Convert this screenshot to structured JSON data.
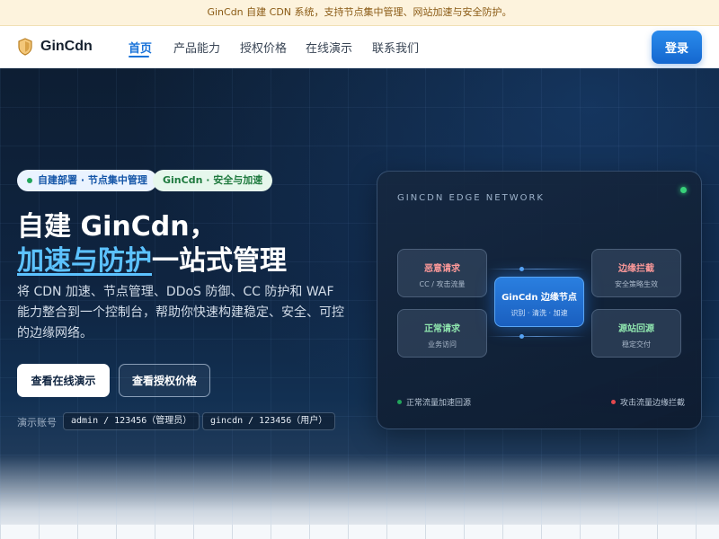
{
  "announcement": "GinCdn 自建 CDN 系统，支持节点集中管理、网站加速与安全防护。",
  "brand": {
    "name": "GinCdn"
  },
  "nav": {
    "items": [
      {
        "label": "首页",
        "active": true
      },
      {
        "label": "产品能力"
      },
      {
        "label": "授权价格"
      },
      {
        "label": "在线演示"
      },
      {
        "label": "联系我们"
      }
    ],
    "login": "登录"
  },
  "hero": {
    "badges": [
      "自建部署 · 节点集中管理",
      "GinCdn · 安全与加速"
    ],
    "title_line1": "自建 GinCdn，",
    "title_highlight": "加速与防护",
    "title_rest": "一站式管理",
    "description": "将 CDN 加速、节点管理、DDoS 防御、CC 防护和 WAF 能力整合到一个控制台，帮助你快速构建稳定、安全、可控的边缘网络。",
    "primary_button": "查看在线演示",
    "secondary_button": "查看授权价格",
    "demo_label": "演示账号",
    "demo_accounts": [
      "admin / 123456（管理员）",
      "gincdn / 123456（用户）"
    ]
  },
  "network_panel": {
    "title": "GINCDN EDGE NETWORK",
    "nodes": {
      "malicious": {
        "title": "恶意请求",
        "sub": "CC / 攻击流量"
      },
      "normal": {
        "title": "正常请求",
        "sub": "业务访问"
      },
      "core": {
        "title": "GinCdn 边缘节点",
        "sub": "识别 · 清洗 · 加速"
      },
      "block": {
        "title": "边缘拦截",
        "sub": "安全策略生效"
      },
      "origin": {
        "title": "源站回源",
        "sub": "稳定交付"
      }
    },
    "legend": [
      "正常流量加速回源",
      "攻击流量边缘拦截"
    ]
  },
  "colors": {
    "accent": "#1a73d9",
    "highlight": "#5cc2ff",
    "status_ok": "#22a55b",
    "status_attack": "#e5484d"
  }
}
